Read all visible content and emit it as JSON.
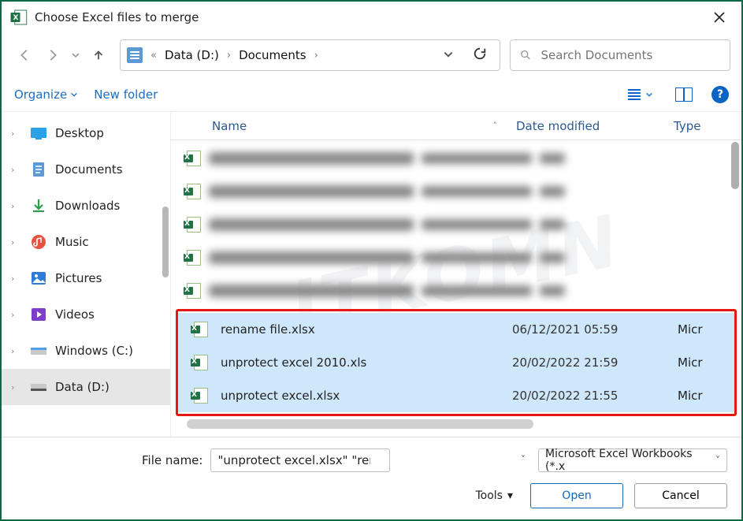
{
  "title": "Choose Excel files to merge",
  "breadcrumb": {
    "segments": [
      "Data (D:)",
      "Documents"
    ],
    "lead": "«"
  },
  "search": {
    "placeholder": "Search Documents"
  },
  "org": {
    "organize": "Organize",
    "newfolder": "New folder"
  },
  "sidebar": {
    "items": [
      {
        "label": "Desktop"
      },
      {
        "label": "Documents"
      },
      {
        "label": "Downloads"
      },
      {
        "label": "Music"
      },
      {
        "label": "Pictures"
      },
      {
        "label": "Videos"
      },
      {
        "label": "Windows  (C:)"
      },
      {
        "label": "Data (D:)"
      }
    ]
  },
  "columns": {
    "name": "Name",
    "date": "Date modified",
    "type": "Type"
  },
  "files": {
    "selected": [
      {
        "name": "rename file.xlsx",
        "date": "06/12/2021 05:59",
        "type": "Micr"
      },
      {
        "name": "unprotect excel 2010.xls",
        "date": "20/02/2022 21:59",
        "type": "Micr"
      },
      {
        "name": "unprotect excel.xlsx",
        "date": "20/02/2022 21:55",
        "type": "Micr"
      }
    ]
  },
  "footer": {
    "label": "File name:",
    "value": "\"unprotect excel.xlsx\" \"rename file.xlsx\" \"unpro",
    "filter": "Microsoft Excel Workbooks (*.x",
    "tools": "Tools",
    "open": "Open",
    "cancel": "Cancel"
  },
  "watermark": "ITKOMN"
}
